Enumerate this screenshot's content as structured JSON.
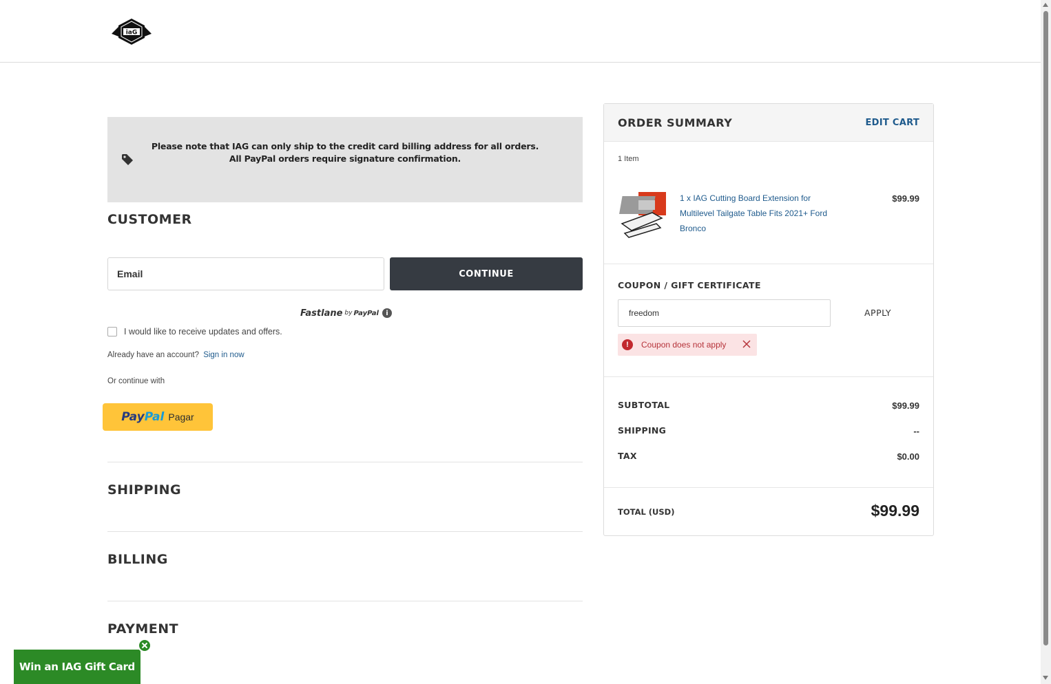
{
  "header": {
    "logo_alt": "IAG"
  },
  "notice": {
    "line1": "Please note that IAG can only ship to the credit card billing address for all orders.",
    "line2": "All PayPal orders require signature confirmation."
  },
  "customer": {
    "title": "CUSTOMER",
    "email_placeholder": "Email",
    "continue_label": "CONTINUE",
    "fastlane": {
      "brand": "Fastlane",
      "by": "by",
      "paypal": "PayPal"
    },
    "updates_label": "I would like to receive updates and offers.",
    "account_text": "Already have an account?",
    "sign_in_label": "Sign in now",
    "continue_with": "Or continue with",
    "paypal_button": {
      "pay": "Pay",
      "pal": "Pal",
      "label": "Pagar"
    }
  },
  "sections": {
    "shipping": "SHIPPING",
    "billing": "BILLING",
    "payment": "PAYMENT"
  },
  "order_summary": {
    "title": "ORDER SUMMARY",
    "edit_cart": "EDIT CART",
    "item_count": "1 Item",
    "product": {
      "name": "1 x IAG Cutting Board Extension for Multilevel Tailgate Table Fits 2021+ Ford Bronco",
      "price": "$99.99"
    },
    "coupon": {
      "title": "COUPON / GIFT CERTIFICATE",
      "value": "freedom",
      "apply_label": "APPLY",
      "error": "Coupon does not apply"
    },
    "rows": [
      {
        "label": "SUBTOTAL",
        "value": "$99.99"
      },
      {
        "label": "SHIPPING",
        "value": "--"
      },
      {
        "label": "TAX",
        "value": "$0.00"
      }
    ],
    "total_label": "TOTAL (USD)",
    "total_value": "$99.99"
  },
  "gift_popup": {
    "label": "Win an IAG Gift Card"
  },
  "colors": {
    "accent_link": "#1e5a8c",
    "button_dark": "#363b42",
    "paypal_yellow": "#ffc439",
    "gift_green": "#2c8a26",
    "error_red": "#c2282e"
  }
}
